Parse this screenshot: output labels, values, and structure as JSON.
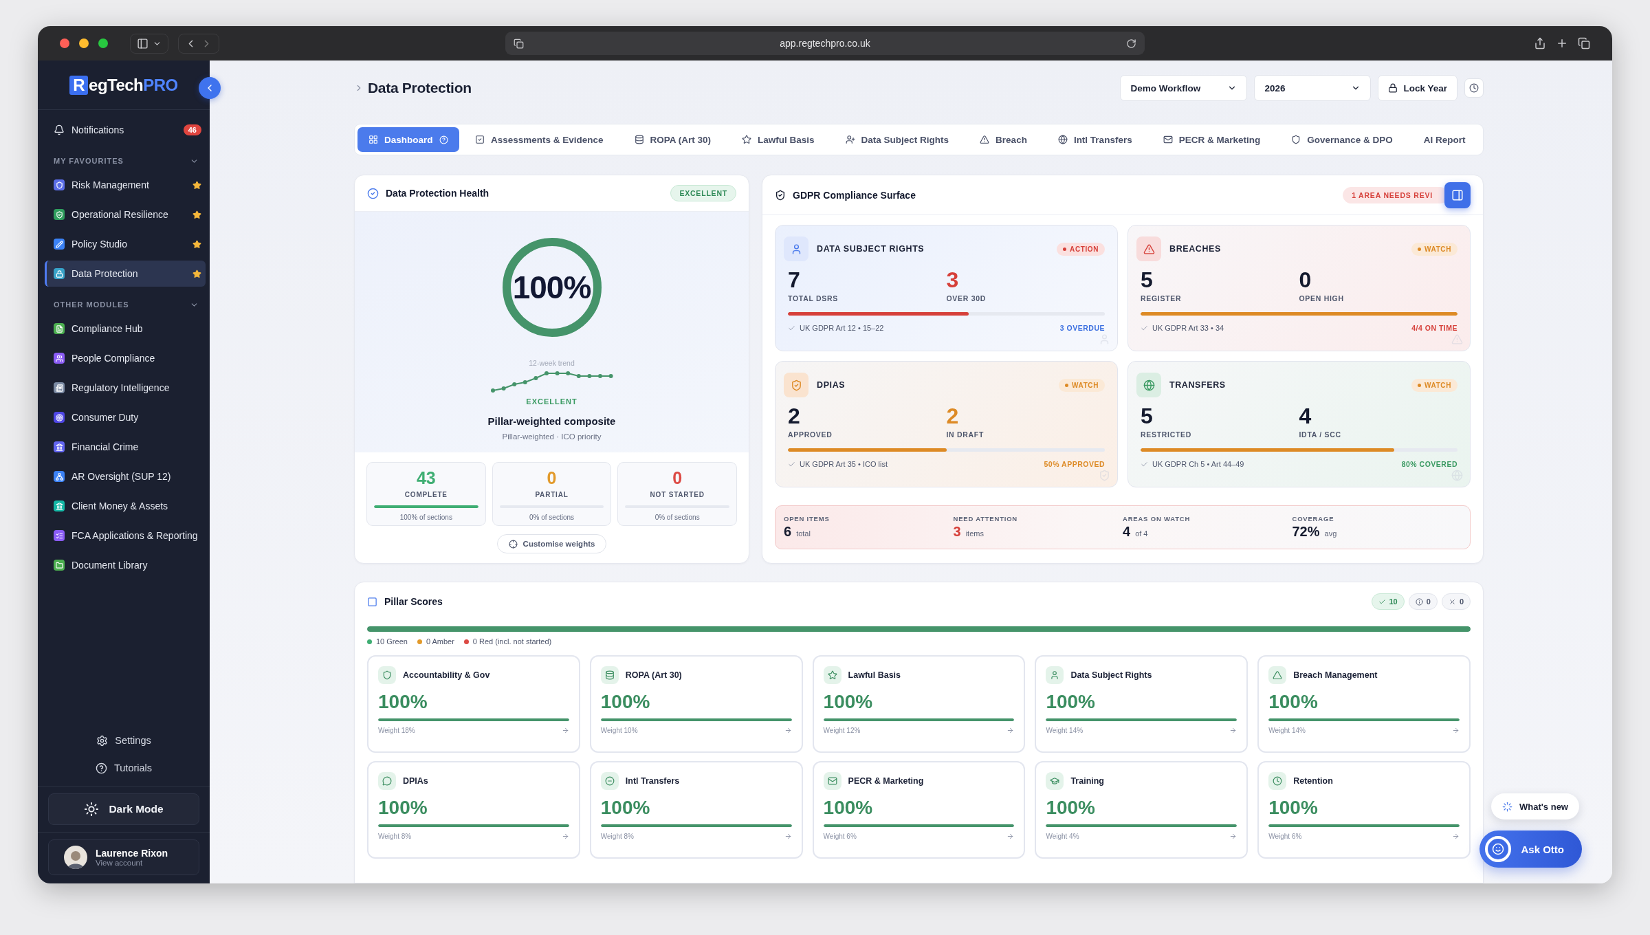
{
  "browser": {
    "url": "app.regtechpro.co.uk"
  },
  "sidebar": {
    "logo": {
      "mark": "R",
      "name": "egTech",
      "suffix": "PRO"
    },
    "notifications": {
      "label": "Notifications",
      "count": "46"
    },
    "sections": [
      {
        "title": "MY FAVOURITES",
        "expanded": true,
        "items": [
          {
            "label": "Risk Management",
            "color": "#5b6ee8",
            "starred": true,
            "selected": false
          },
          {
            "label": "Operational Resilience",
            "color": "#2f9e5e",
            "starred": true,
            "selected": false
          },
          {
            "label": "Policy Studio",
            "color": "#3b82f6",
            "starred": true,
            "selected": false
          },
          {
            "label": "Data Protection",
            "color": "#38a3c9",
            "starred": true,
            "selected": true
          }
        ]
      },
      {
        "title": "OTHER MODULES",
        "expanded": true,
        "items": [
          {
            "label": "Compliance Hub",
            "color": "#4caf50",
            "starred": false,
            "selected": false
          },
          {
            "label": "People Compliance",
            "color": "#8b5cf6",
            "starred": false,
            "selected": false
          },
          {
            "label": "Regulatory Intelligence",
            "color": "#7b8aa3",
            "starred": false,
            "selected": false
          },
          {
            "label": "Consumer Duty",
            "color": "#4f46e5",
            "starred": false,
            "selected": false
          },
          {
            "label": "Financial Crime",
            "color": "#6366f1",
            "starred": false,
            "selected": false
          },
          {
            "label": "AR Oversight (SUP 12)",
            "color": "#3b82f6",
            "starred": false,
            "selected": false
          },
          {
            "label": "Client Money & Assets",
            "color": "#14b8a6",
            "starred": false,
            "selected": false
          },
          {
            "label": "FCA Applications & Reporting",
            "color": "#8b5cf6",
            "starred": false,
            "selected": false
          },
          {
            "label": "Document Library",
            "color": "#4caf50",
            "starred": false,
            "selected": false
          }
        ]
      }
    ],
    "footer": [
      {
        "label": "Settings"
      },
      {
        "label": "Tutorials"
      }
    ],
    "dark_mode": {
      "label": "Dark Mode"
    },
    "user": {
      "name": "Laurence Rixon",
      "subtitle": "View account"
    }
  },
  "header": {
    "title": "Data Protection",
    "workflow": "Demo Workflow",
    "year": "2026",
    "lock": "Lock Year"
  },
  "tabs": [
    {
      "label": "Dashboard",
      "selected": true
    },
    {
      "label": "Assessments & Evidence",
      "selected": false
    },
    {
      "label": "ROPA (Art 30)",
      "selected": false
    },
    {
      "label": "Lawful Basis",
      "selected": false
    },
    {
      "label": "Data Subject Rights",
      "selected": false
    },
    {
      "label": "Breach",
      "selected": false
    },
    {
      "label": "Intl Transfers",
      "selected": false
    },
    {
      "label": "PECR & Marketing",
      "selected": false
    },
    {
      "label": "Governance & DPO",
      "selected": false
    },
    {
      "label": "AI Report",
      "selected": false
    }
  ],
  "health": {
    "title": "Data Protection Health",
    "badge": "EXCELLENT",
    "score": {
      "value": "100%",
      "level": 1
    },
    "trend_label": "12-week trend",
    "status": "EXCELLENT",
    "caption": "Pillar-weighted composite",
    "subcaption": "Pillar-weighted · ICO priority",
    "stats": [
      {
        "value": "43",
        "label": "COMPLETE",
        "color": "#3fae73",
        "level": 1,
        "note": "100% of sections"
      },
      {
        "value": "0",
        "label": "PARTIAL",
        "color": "#e29a2b",
        "note": "0% of sections"
      },
      {
        "value": "0",
        "label": "NOT STARTED",
        "color": "#dc4a44",
        "note": "0% of sections"
      }
    ],
    "action": "Customise weights"
  },
  "gdpr": {
    "title": "GDPR Compliance Surface",
    "badge": "1 AREA NEEDS REVI",
    "areas": [
      {
        "kind": "rights",
        "title": "DATA SUBJECT RIGHTS",
        "status": {
          "kind": "action",
          "label": "ACTION"
        },
        "metrics": [
          {
            "value": "7",
            "label": "TOTAL DSRS",
            "color": "#141a2e"
          },
          {
            "value": "3",
            "label": "OVER 30D",
            "color": "#d6403a"
          }
        ],
        "bar": {
          "level": 0.57,
          "color": "#d6403a"
        },
        "reference": "UK GDPR Art 12 • 15–22",
        "note": {
          "text": "3 OVERDUE",
          "color": "#3b6fe0"
        }
      },
      {
        "kind": "breach",
        "title": "BREACHES",
        "status": {
          "kind": "watch",
          "label": "WATCH"
        },
        "metrics": [
          {
            "value": "5",
            "label": "REGISTER",
            "color": "#141a2e"
          },
          {
            "value": "0",
            "label": "OPEN HIGH",
            "color": "#141a2e"
          }
        ],
        "bar": {
          "level": 1,
          "color": "#dd8a25"
        },
        "reference": "UK GDPR Art 33 • 34",
        "note": {
          "text": "4/4 ON TIME",
          "color": "#d6403a"
        }
      },
      {
        "kind": "dpia",
        "title": "DPIAS",
        "status": {
          "kind": "watch",
          "label": "WATCH"
        },
        "metrics": [
          {
            "value": "2",
            "label": "APPROVED",
            "color": "#141a2e"
          },
          {
            "value": "2",
            "label": "IN DRAFT",
            "color": "#dd8a25"
          }
        ],
        "bar": {
          "level": 0.5,
          "color": "#dd8a25"
        },
        "reference": "UK GDPR Art 35 • ICO list",
        "note": {
          "text": "50% APPROVED",
          "color": "#dd8a25"
        }
      },
      {
        "kind": "transfer",
        "title": "TRANSFERS",
        "status": {
          "kind": "watch",
          "label": "WATCH"
        },
        "metrics": [
          {
            "value": "5",
            "label": "RESTRICTED",
            "color": "#141a2e"
          },
          {
            "value": "4",
            "label": "IDTA / SCC",
            "color": "#141a2e"
          }
        ],
        "bar": {
          "level": 0.8,
          "color": "#dd8a25"
        },
        "reference": "UK GDPR Ch 5 • Art 44–49",
        "note": {
          "text": "80% COVERED",
          "color": "#3a9a62"
        }
      }
    ],
    "summary": [
      {
        "label": "OPEN ITEMS",
        "value": "6",
        "unit": "total",
        "color": "#141a2e"
      },
      {
        "label": "NEED ATTENTION",
        "value": "3",
        "unit": "items",
        "color": "#d6403a"
      },
      {
        "label": "AREAS ON WATCH",
        "value": "4",
        "unit": "of 4",
        "color": "#141a2e"
      },
      {
        "label": "COVERAGE",
        "value": "72%",
        "unit": "avg",
        "color": "#141a2e"
      }
    ]
  },
  "pillars": {
    "title": "Pillar Scores",
    "chips": [
      {
        "kind": "pass",
        "count": "10"
      },
      {
        "kind": "info",
        "count": "0"
      },
      {
        "kind": "fail",
        "count": "0"
      }
    ],
    "overall": {
      "level": 1
    },
    "legend": [
      {
        "label": "10 Green",
        "color": "#3fae73"
      },
      {
        "label": "0 Amber",
        "color": "#e29a2b"
      },
      {
        "label": "0 Red (incl. not started)",
        "color": "#dc4a44"
      }
    ],
    "items": [
      {
        "name": "Accountability & Gov",
        "score": "100%",
        "level": 1,
        "weight": "Weight 18%"
      },
      {
        "name": "ROPA (Art 30)",
        "score": "100%",
        "level": 1,
        "weight": "Weight 10%"
      },
      {
        "name": "Lawful Basis",
        "score": "100%",
        "level": 1,
        "weight": "Weight 12%"
      },
      {
        "name": "Data Subject Rights",
        "score": "100%",
        "level": 1,
        "weight": "Weight 14%"
      },
      {
        "name": "Breach Management",
        "score": "100%",
        "level": 1,
        "weight": "Weight 14%"
      },
      {
        "name": "DPIAs",
        "score": "100%",
        "level": 1,
        "weight": "Weight 8%"
      },
      {
        "name": "Intl Transfers",
        "score": "100%",
        "level": 1,
        "weight": "Weight 8%"
      },
      {
        "name": "PECR & Marketing",
        "score": "100%",
        "level": 1,
        "weight": "Weight 6%"
      },
      {
        "name": "Training",
        "score": "100%",
        "level": 1,
        "weight": "Weight 4%"
      },
      {
        "name": "Retention",
        "score": "100%",
        "level": 1,
        "weight": "Weight 6%"
      }
    ]
  },
  "floating": {
    "whats_new": "What's new",
    "assistant": "Ask Otto"
  }
}
